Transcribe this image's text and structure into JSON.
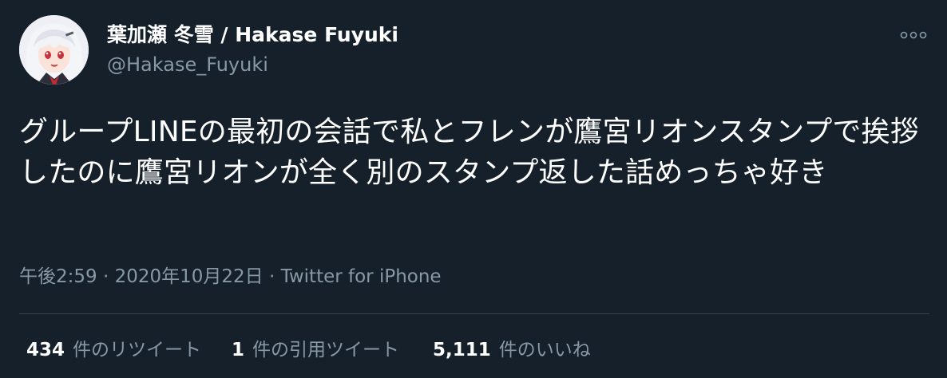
{
  "tweet": {
    "display_name": "葉加瀬 冬雪 / Hakase Fuyuki",
    "handle": "@Hakase_Fuyuki",
    "text": "グループLINEの最初の会話で私とフレンが鷹宮リオンスタンプで挨拶したのに鷹宮リオンが全く別のスタンプ返した話めっちゃ好き",
    "time": "午後2:59",
    "separator": " · ",
    "date": "2020年10月22日",
    "source": "Twitter for iPhone"
  },
  "stats": {
    "retweets": {
      "count": "434",
      "label": "件のリツイート"
    },
    "quotes": {
      "count": "1",
      "label": "件の引用ツイート"
    },
    "likes": {
      "count": "5,111",
      "label": "件のいいね"
    }
  },
  "icons": {
    "more": "more-horizontal-icon",
    "avatar": "avatar-image"
  },
  "colors": {
    "background": "#15202b",
    "primary_text": "#ffffff",
    "secondary_text": "#8899a6",
    "divider": "#38444d"
  }
}
